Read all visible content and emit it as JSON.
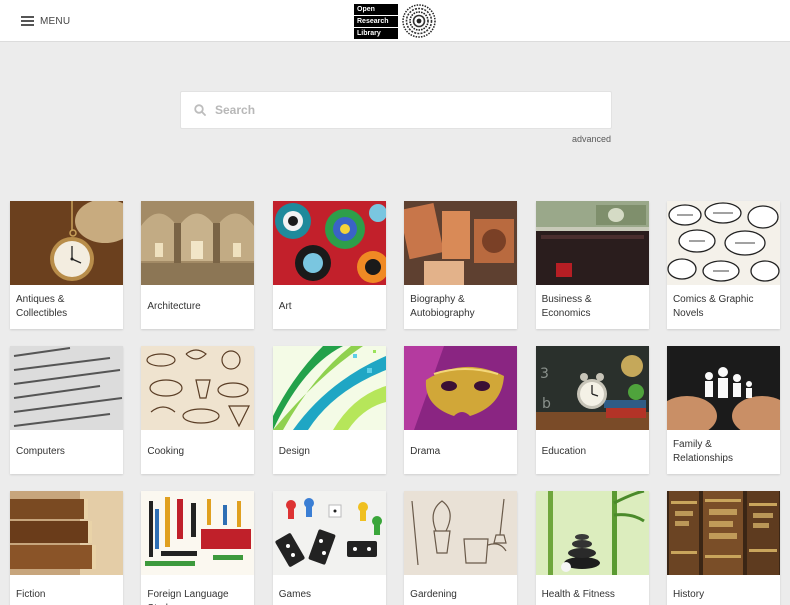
{
  "header": {
    "menu_label": "MENU",
    "logo": {
      "line1": "Open",
      "line2": "Research",
      "line3": "Library"
    }
  },
  "search": {
    "placeholder": "Search",
    "value": "",
    "advanced_label": "advanced"
  },
  "categories": [
    {
      "label": "Antiques & Collectibles",
      "image": "pocket-watch"
    },
    {
      "label": "Architecture",
      "image": "vaulted-hall"
    },
    {
      "label": "Art",
      "image": "colorful-swirls"
    },
    {
      "label": "Biography & Autobiography",
      "image": "wooden-letters"
    },
    {
      "label": "Business & Economics",
      "image": "banknotes-wallet"
    },
    {
      "label": "Comics & Graphic Novels",
      "image": "comic-speech-bubbles"
    },
    {
      "label": "Computers",
      "image": "html-code"
    },
    {
      "label": "Cooking",
      "image": "food-sketches"
    },
    {
      "label": "Design",
      "image": "green-swoosh"
    },
    {
      "label": "Drama",
      "image": "gold-mask"
    },
    {
      "label": "Education",
      "image": "alarm-clock-books"
    },
    {
      "label": "Family & Relationships",
      "image": "paper-family-hands"
    },
    {
      "label": "Fiction",
      "image": "old-books-stack"
    },
    {
      "label": "Foreign Language Study",
      "image": "welcome-word-cloud"
    },
    {
      "label": "Games",
      "image": "dominoes-dice"
    },
    {
      "label": "Gardening",
      "image": "garden-tools-sketch"
    },
    {
      "label": "Health & Fitness",
      "image": "zen-stones-bamboo"
    },
    {
      "label": "History",
      "image": "antique-book-spines"
    }
  ]
}
